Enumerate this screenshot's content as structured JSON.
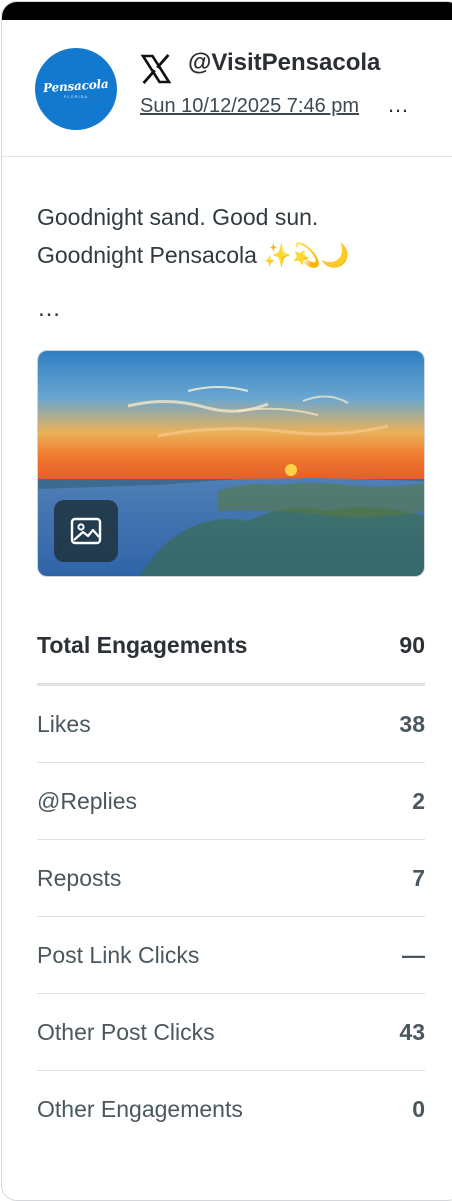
{
  "account": {
    "handle": "@VisitPensacola",
    "network_icon": "x-logo-icon",
    "timestamp": "Sun 10/12/2025 7:46 pm ",
    "timestamp_more": "…",
    "avatar_text": "Pensacola",
    "avatar_subtext": "FLORIDA",
    "avatar_color": "#1279cf"
  },
  "post": {
    "lines": [
      "Goodnight sand. Good sun.",
      "Goodnight Pensacola ✨💫🌙"
    ],
    "more": "…",
    "media_icon": "image-icon"
  },
  "metrics": {
    "total": {
      "label": "Total Engagements",
      "value": "90"
    },
    "rows": [
      {
        "label": "Likes",
        "value": "38"
      },
      {
        "label": "@Replies",
        "value": "2"
      },
      {
        "label": "Reposts",
        "value": "7"
      },
      {
        "label": "Post Link Clicks",
        "value": "—"
      },
      {
        "label": "Other Post Clicks",
        "value": "43"
      },
      {
        "label": "Other Engagements",
        "value": "0"
      }
    ]
  }
}
